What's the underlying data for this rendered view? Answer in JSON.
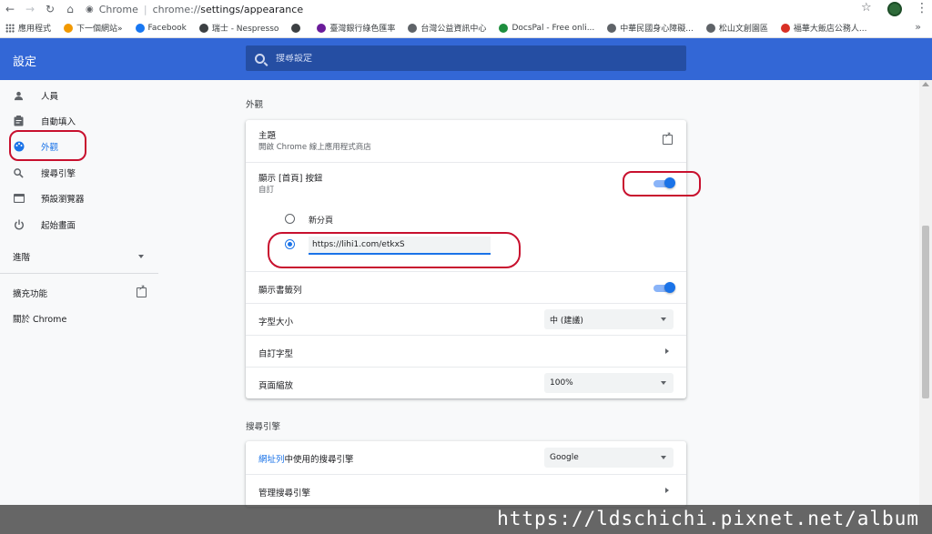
{
  "browser": {
    "site_label": "Chrome",
    "url_prefix": "chrome://",
    "url_path": "settings/appearance"
  },
  "bookmarks": [
    {
      "label": "應用程式",
      "color": "#5f6368"
    },
    {
      "label": "下一個網站»",
      "color": "#f29900"
    },
    {
      "label": "Facebook",
      "color": "#1877f2"
    },
    {
      "label": "瑞士 - Nespresso",
      "color": "#3c4043"
    },
    {
      "label": "",
      "color": "#3c4043"
    },
    {
      "label": "臺灣銀行綠色匯率",
      "color": "#6a1b9a"
    },
    {
      "label": "台灣公益資訊中心",
      "color": "#5f6368"
    },
    {
      "label": "DocsPal - Free onli...",
      "color": "#1e8e3e"
    },
    {
      "label": "中華民國身心障礙...",
      "color": "#5f6368"
    },
    {
      "label": "松山文創園區",
      "color": "#5f6368"
    },
    {
      "label": "福華大飯店公務人...",
      "color": "#d93025"
    }
  ],
  "header": {
    "title": "設定",
    "search_placeholder": "搜尋設定"
  },
  "sidebar": {
    "items": [
      {
        "label": "人員",
        "icon": "person-icon"
      },
      {
        "label": "自動填入",
        "icon": "clipboard-icon"
      },
      {
        "label": "外觀",
        "icon": "palette-icon"
      },
      {
        "label": "搜尋引擎",
        "icon": "search-icon"
      },
      {
        "label": "預設瀏覽器",
        "icon": "browser-icon"
      },
      {
        "label": "起始畫面",
        "icon": "power-icon"
      }
    ],
    "advanced": "進階",
    "extensions": "擴充功能",
    "about": "關於 Chrome"
  },
  "appearance": {
    "section_title": "外觀",
    "theme_title": "主題",
    "theme_sub": "開啟 Chrome 線上應用程式商店",
    "home_title": "顯示 [首頁] 按鈕",
    "home_sub": "自訂",
    "home_toggle_on": true,
    "radio_new_tab": "新分頁",
    "custom_url": "https://lihi1.com/etkxS",
    "bookmarks_bar": "顯示書籤列",
    "bookmarks_toggle_on": true,
    "font_size": "字型大小",
    "font_size_value": "中 (建議)",
    "custom_fonts": "自訂字型",
    "page_zoom": "頁面縮放",
    "page_zoom_value": "100%"
  },
  "search_engine": {
    "section_title": "搜尋引擎",
    "row_prefix": "網址列",
    "row_suffix": "中使用的搜尋引擎",
    "engine_value": "Google",
    "manage": "管理搜尋引擎"
  },
  "watermark": "https://ldschichi.pixnet.net/album",
  "colors": {
    "header": "#3367d6",
    "accent": "#1a73e8",
    "annotation": "#c8102e"
  }
}
